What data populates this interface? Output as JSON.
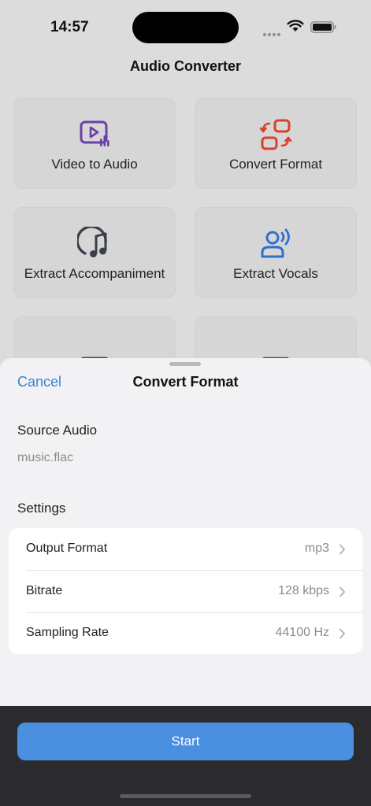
{
  "status_bar": {
    "time": "14:57",
    "wifi_icon": "wifi-icon",
    "battery_icon": "battery-icon"
  },
  "app": {
    "title": "Audio Converter"
  },
  "tools": [
    {
      "label": "Video to Audio",
      "icon": "video-to-audio-icon",
      "color": "#6a3fa8"
    },
    {
      "label": "Convert Format",
      "icon": "convert-format-icon",
      "color": "#d9412e"
    },
    {
      "label": "Extract Accompaniment",
      "icon": "music-note-icon",
      "color": "#3a3f4a"
    },
    {
      "label": "Extract Vocals",
      "icon": "vocals-icon",
      "color": "#2f6fd0"
    },
    {
      "label": "",
      "icon": "trim-icon",
      "color": "#3f4a5a"
    },
    {
      "label": "",
      "icon": "merge-icon",
      "color": "#3f4a5a"
    }
  ],
  "sheet": {
    "cancel_label": "Cancel",
    "title": "Convert Format",
    "source_header": "Source Audio",
    "source_file": "music.flac",
    "settings_header": "Settings",
    "settings": [
      {
        "label": "Output Format",
        "value": "mp3"
      },
      {
        "label": "Bitrate",
        "value": "128 kbps"
      },
      {
        "label": "Sampling Rate",
        "value": "44100 Hz"
      }
    ]
  },
  "actions": {
    "start_label": "Start"
  },
  "colors": {
    "accent": "#3a82d8",
    "button": "#4a8fe0"
  }
}
